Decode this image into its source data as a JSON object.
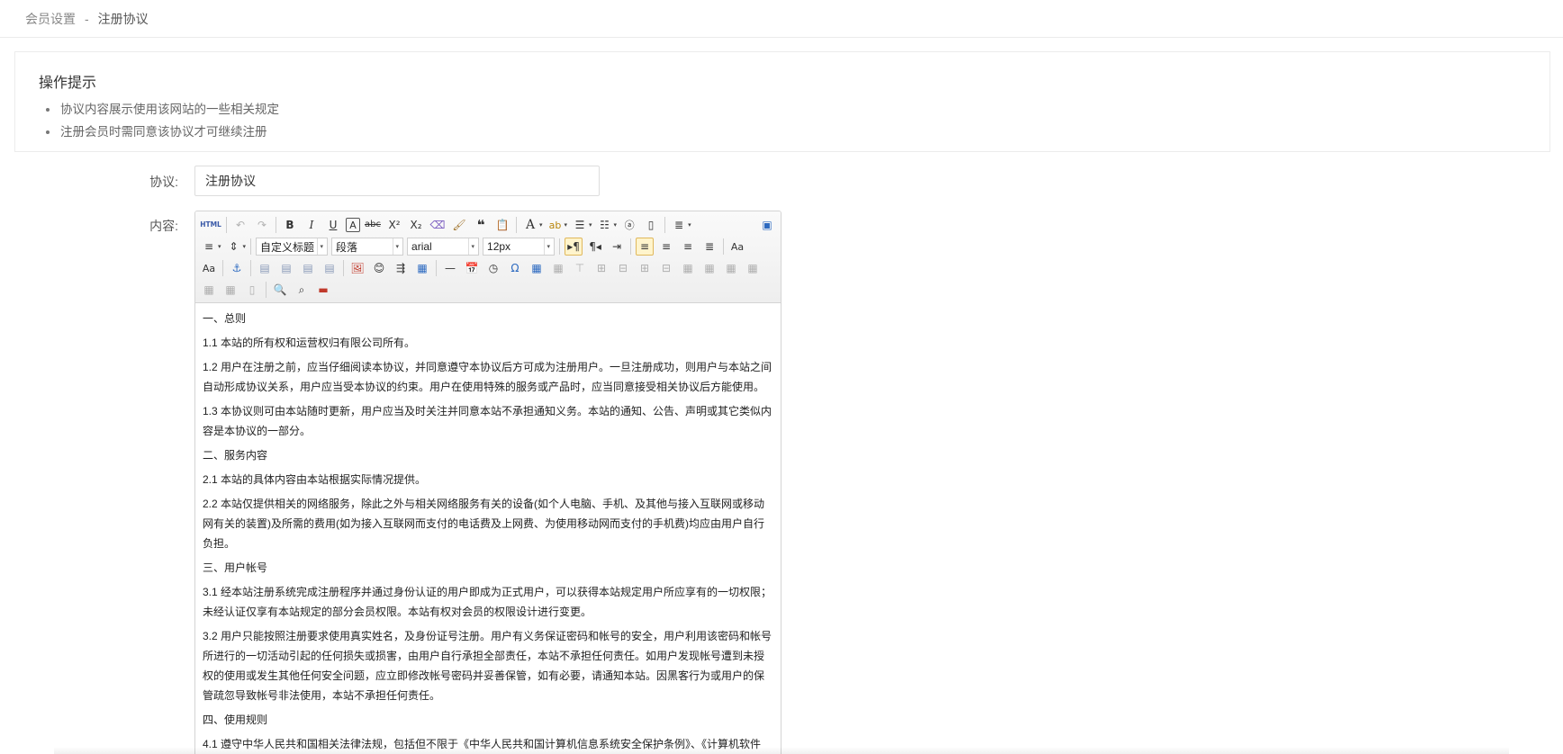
{
  "breadcrumb": {
    "parent": "会员设置",
    "separator": "-",
    "current": "注册协议"
  },
  "tips": {
    "title": "操作提示",
    "items": [
      "协议内容展示使用该网站的一些相关规定",
      "注册会员时需同意该协议才可继续注册"
    ]
  },
  "form": {
    "title_label": "协议:",
    "title_value": "注册协议",
    "content_label": "内容:"
  },
  "toolbar": {
    "html_label": "HTML",
    "selects": {
      "heading": "自定义标题",
      "paragraph": "段落",
      "font": "arial",
      "size": "12px"
    }
  },
  "content": {
    "paragraphs": [
      "一、总则",
      "1.1 本站的所有权和运营权归有限公司所有。",
      "1.2 用户在注册之前，应当仔细阅读本协议，并同意遵守本协议后方可成为注册用户。一旦注册成功，则用户与本站之间自动形成协议关系，用户应当受本协议的约束。用户在使用特殊的服务或产品时，应当同意接受相关协议后方能使用。",
      "1.3 本协议则可由本站随时更新，用户应当及时关注并同意本站不承担通知义务。本站的通知、公告、声明或其它类似内容是本协议的一部分。",
      "二、服务内容",
      "2.1 本站的具体内容由本站根据实际情况提供。",
      "2.2 本站仅提供相关的网络服务，除此之外与相关网络服务有关的设备(如个人电脑、手机、及其他与接入互联网或移动网有关的装置)及所需的费用(如为接入互联网而支付的电话费及上网费、为使用移动网而支付的手机费)均应由用户自行负担。",
      "三、用户帐号",
      "3.1 经本站注册系统完成注册程序并通过身份认证的用户即成为正式用户，可以获得本站规定用户所应享有的一切权限；未经认证仅享有本站规定的部分会员权限。本站有权对会员的权限设计进行变更。",
      "3.2 用户只能按照注册要求使用真实姓名，及身份证号注册。用户有义务保证密码和帐号的安全，用户利用该密码和帐号所进行的一切活动引起的任何损失或损害，由用户自行承担全部责任，本站不承担任何责任。如用户发现帐号遭到未授权的使用或发生其他任何安全问题，应立即修改帐号密码并妥善保管，如有必要，请通知本站。因黑客行为或用户的保管疏忽导致帐号非法使用，本站不承担任何责任。",
      "四、使用规则",
      "4.1 遵守中华人民共和国相关法律法规，包括但不限于《中华人民共和国计算机信息系统安全保护条例》、《计算机软件"
    ]
  }
}
